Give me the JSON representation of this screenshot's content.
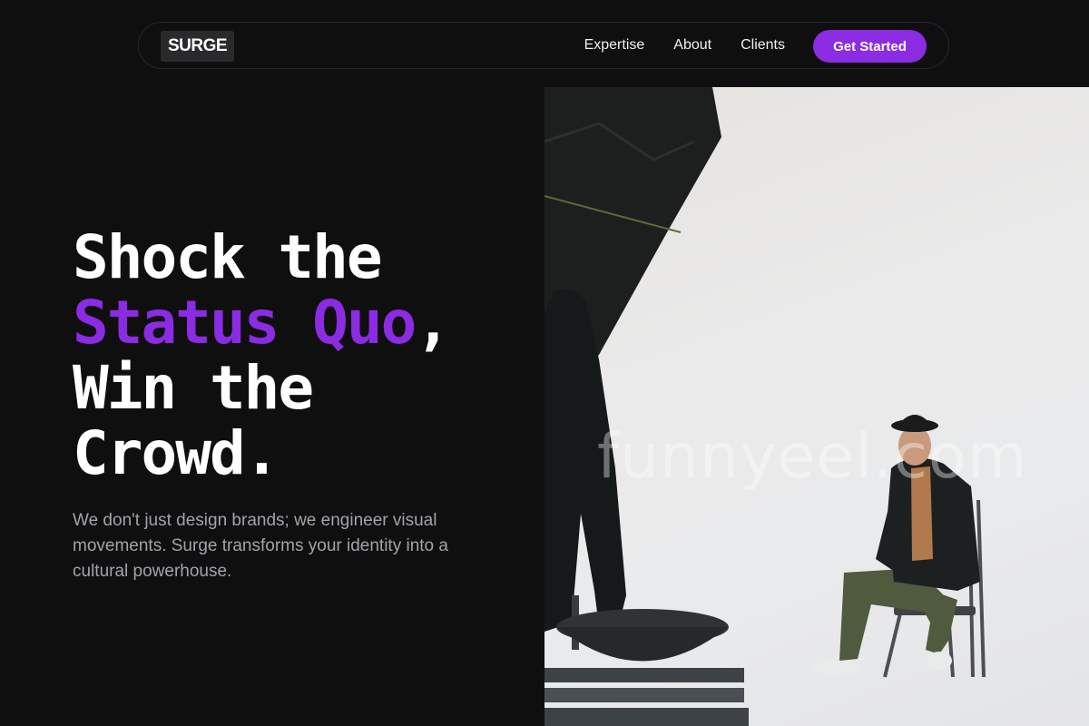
{
  "nav": {
    "logo": "SURGE",
    "links": [
      "Expertise",
      "About",
      "Clients"
    ],
    "cta_label": "Get Started"
  },
  "hero": {
    "headline_line1": "Shock the",
    "headline_accent": "Status Quo",
    "headline_comma": ",",
    "headline_line3": "Win the",
    "headline_line4": "Crowd.",
    "subtext": "We don't just design brands; we engineer visual movements. Surge transforms your identity into a cultural powerhouse.",
    "image_watermark": "funnyeel.com"
  },
  "colors": {
    "background": "#0f0f10",
    "accent": "#8b2be2",
    "text": "#ffffff",
    "muted_text": "#a3a3ab"
  }
}
